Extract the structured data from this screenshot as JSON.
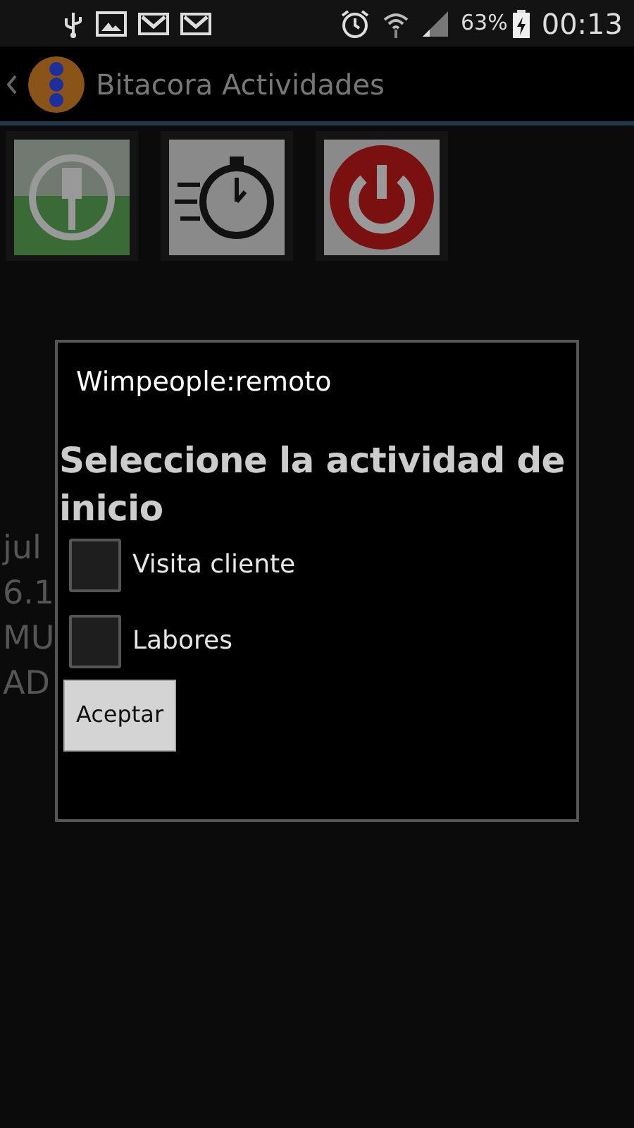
{
  "status_bar": {
    "battery": "63%",
    "time": "00:13"
  },
  "action_bar": {
    "title": "Bitacora Actividades"
  },
  "background_lines": [
    "jul",
    "6.1",
    "MU",
    "AD"
  ],
  "dialog": {
    "title": "Wimpeople:remoto",
    "message": "Seleccione la actividad de inicio",
    "options": [
      {
        "label": "Visita cliente",
        "checked": false
      },
      {
        "label": "Labores",
        "checked": false
      }
    ],
    "button": "Aceptar"
  }
}
